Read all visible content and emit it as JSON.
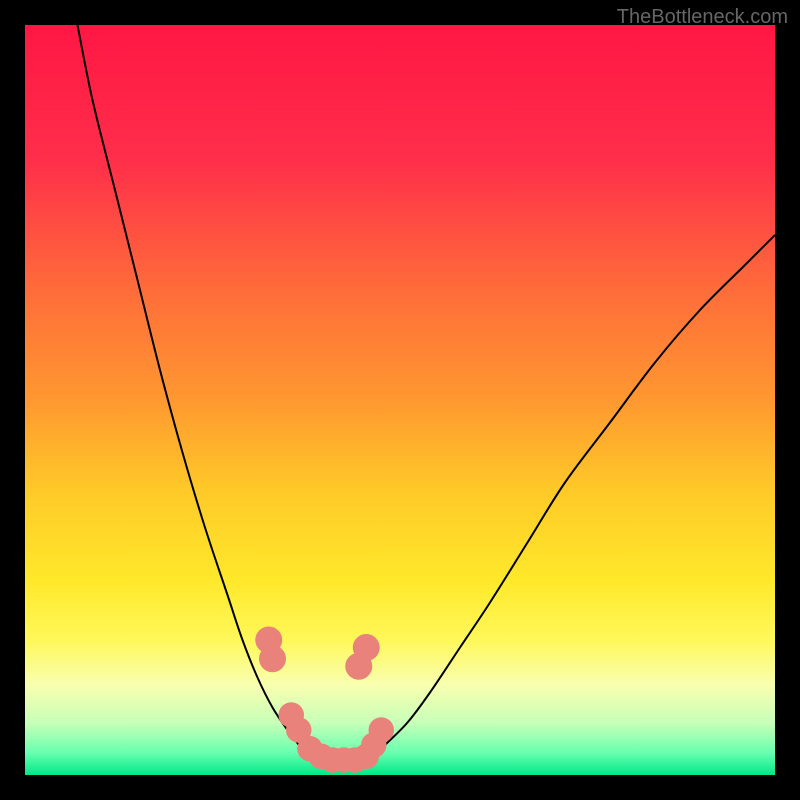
{
  "watermark": "TheBottleneck.com",
  "chart_data": {
    "type": "line",
    "title": "",
    "xlabel": "",
    "ylabel": "",
    "xlim": [
      0,
      100
    ],
    "ylim": [
      0,
      100
    ],
    "gradient_stops": [
      {
        "offset": 0,
        "color": "#ff1744"
      },
      {
        "offset": 18,
        "color": "#ff2e4a"
      },
      {
        "offset": 35,
        "color": "#ff6b3a"
      },
      {
        "offset": 50,
        "color": "#ff9830"
      },
      {
        "offset": 62,
        "color": "#ffc928"
      },
      {
        "offset": 74,
        "color": "#ffe82a"
      },
      {
        "offset": 82,
        "color": "#fff85a"
      },
      {
        "offset": 88,
        "color": "#f8ffb0"
      },
      {
        "offset": 93,
        "color": "#c8ffb8"
      },
      {
        "offset": 97,
        "color": "#6affb0"
      },
      {
        "offset": 100,
        "color": "#00e888"
      }
    ],
    "series": [
      {
        "name": "left-curve",
        "description": "Descending curve from top-left to bottom valley",
        "points": [
          {
            "x": 7,
            "y": 0
          },
          {
            "x": 9,
            "y": 10
          },
          {
            "x": 12,
            "y": 22
          },
          {
            "x": 15,
            "y": 34
          },
          {
            "x": 18,
            "y": 46
          },
          {
            "x": 21,
            "y": 57
          },
          {
            "x": 24,
            "y": 67
          },
          {
            "x": 27,
            "y": 76
          },
          {
            "x": 29,
            "y": 82
          },
          {
            "x": 31,
            "y": 87
          },
          {
            "x": 33,
            "y": 91
          },
          {
            "x": 35,
            "y": 94
          },
          {
            "x": 37,
            "y": 96.5
          },
          {
            "x": 39,
            "y": 98
          }
        ]
      },
      {
        "name": "right-curve",
        "description": "Ascending curve from bottom valley to upper-right",
        "points": [
          {
            "x": 46,
            "y": 98
          },
          {
            "x": 48,
            "y": 96
          },
          {
            "x": 51,
            "y": 93
          },
          {
            "x": 54,
            "y": 89
          },
          {
            "x": 58,
            "y": 83
          },
          {
            "x": 62,
            "y": 77
          },
          {
            "x": 67,
            "y": 69
          },
          {
            "x": 72,
            "y": 61
          },
          {
            "x": 78,
            "y": 53
          },
          {
            "x": 84,
            "y": 45
          },
          {
            "x": 90,
            "y": 38
          },
          {
            "x": 96,
            "y": 32
          },
          {
            "x": 100,
            "y": 28
          }
        ]
      }
    ],
    "markers": [
      {
        "x": 32.5,
        "y": 82,
        "r": 1.8
      },
      {
        "x": 33.0,
        "y": 84.5,
        "r": 1.8
      },
      {
        "x": 35.5,
        "y": 92,
        "r": 1.7
      },
      {
        "x": 36.5,
        "y": 94,
        "r": 1.7
      },
      {
        "x": 38.0,
        "y": 96.5,
        "r": 1.7
      },
      {
        "x": 39.5,
        "y": 97.5,
        "r": 1.7
      },
      {
        "x": 41.0,
        "y": 98,
        "r": 1.7
      },
      {
        "x": 42.5,
        "y": 98,
        "r": 1.7
      },
      {
        "x": 44.0,
        "y": 98,
        "r": 1.7
      },
      {
        "x": 45.5,
        "y": 97.5,
        "r": 1.7
      },
      {
        "x": 46.5,
        "y": 96,
        "r": 1.7
      },
      {
        "x": 47.5,
        "y": 94,
        "r": 1.7
      },
      {
        "x": 44.5,
        "y": 85.5,
        "r": 1.8
      },
      {
        "x": 45.5,
        "y": 83,
        "r": 1.8
      }
    ],
    "marker_color": "#e8827a"
  }
}
